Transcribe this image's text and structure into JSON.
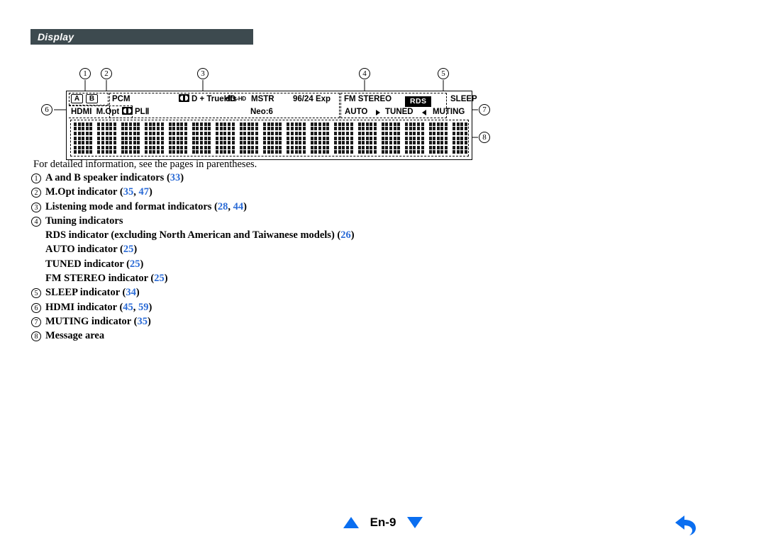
{
  "section": {
    "title": "Display"
  },
  "callouts": [
    {
      "id": "1",
      "glyph": "①"
    },
    {
      "id": "2",
      "glyph": "②"
    },
    {
      "id": "3",
      "glyph": "③"
    },
    {
      "id": "4",
      "glyph": "④"
    },
    {
      "id": "5",
      "glyph": "⑤"
    },
    {
      "id": "6",
      "glyph": "⑥"
    },
    {
      "id": "7",
      "glyph": "⑦"
    },
    {
      "id": "8",
      "glyph": "⑧"
    }
  ],
  "display_panel": {
    "speaker_a": "A",
    "speaker_b": "B",
    "hdmi": "HDMI",
    "m_opt": "M.Opt",
    "pcm": "PCM",
    "dolby_pl2": "PLⅡ",
    "dolby_d_truehd": "D + TrueHD",
    "neo6": "Neo:6",
    "dts_main": "dts",
    "dts_sep": "-",
    "dts_hd": "HD",
    "dts_mstr": "MSTR",
    "exp_9624": "96/24 Exp",
    "fm_stereo": "FM STEREO",
    "rds": "RDS",
    "sleep": "SLEEP",
    "auto": "AUTO",
    "tuned": "TUNED",
    "muting": "MUTING",
    "message_area_cells": 17
  },
  "caption": "For detailed information, see the pages in parentheses.",
  "legend": [
    {
      "marker": "①",
      "sub": false,
      "parts": [
        {
          "t": "A and B speaker indicators ("
        },
        {
          "t": "33",
          "page": true
        },
        {
          "t": ")"
        }
      ]
    },
    {
      "marker": "②",
      "sub": false,
      "parts": [
        {
          "t": "M.Opt indicator ("
        },
        {
          "t": "35",
          "page": true
        },
        {
          "t": ", "
        },
        {
          "t": "47",
          "page": true
        },
        {
          "t": ")"
        }
      ]
    },
    {
      "marker": "③",
      "sub": false,
      "parts": [
        {
          "t": "Listening mode and format indicators ("
        },
        {
          "t": "28",
          "page": true
        },
        {
          "t": ", "
        },
        {
          "t": "44",
          "page": true
        },
        {
          "t": ")"
        }
      ]
    },
    {
      "marker": "④",
      "sub": false,
      "parts": [
        {
          "t": "Tuning indicators"
        }
      ]
    },
    {
      "marker": "",
      "sub": true,
      "parts": [
        {
          "t": "RDS indicator (excluding North American and Taiwanese models) ("
        },
        {
          "t": "26",
          "page": true
        },
        {
          "t": ")"
        }
      ]
    },
    {
      "marker": "",
      "sub": true,
      "parts": [
        {
          "t": "AUTO indicator ("
        },
        {
          "t": "25",
          "page": true
        },
        {
          "t": ")"
        }
      ]
    },
    {
      "marker": "",
      "sub": true,
      "parts": [
        {
          "t": "TUNED indicator ("
        },
        {
          "t": "25",
          "page": true
        },
        {
          "t": ")"
        }
      ]
    },
    {
      "marker": "",
      "sub": true,
      "parts": [
        {
          "t": "FM STEREO indicator ("
        },
        {
          "t": "25",
          "page": true
        },
        {
          "t": ")"
        }
      ]
    },
    {
      "marker": "⑤",
      "sub": false,
      "parts": [
        {
          "t": "SLEEP indicator ("
        },
        {
          "t": "34",
          "page": true
        },
        {
          "t": ")"
        }
      ]
    },
    {
      "marker": "⑥",
      "sub": false,
      "parts": [
        {
          "t": "HDMI indicator ("
        },
        {
          "t": "45",
          "page": true
        },
        {
          "t": ", "
        },
        {
          "t": "59",
          "page": true
        },
        {
          "t": ")"
        }
      ]
    },
    {
      "marker": "⑦",
      "sub": false,
      "parts": [
        {
          "t": "MUTING indicator ("
        },
        {
          "t": "35",
          "page": true
        },
        {
          "t": ")"
        }
      ]
    },
    {
      "marker": "⑧",
      "sub": false,
      "parts": [
        {
          "t": "Message area"
        }
      ]
    }
  ],
  "footer": {
    "page_label": "En-9",
    "prev_icon": "triangle-up-icon",
    "next_icon": "triangle-down-icon",
    "return_icon": "return-arrow-icon"
  },
  "colors": {
    "header_bar": "#3d4a4f",
    "page_ref": "#2b6bd6",
    "nav_blue": "#0a6ef0"
  }
}
